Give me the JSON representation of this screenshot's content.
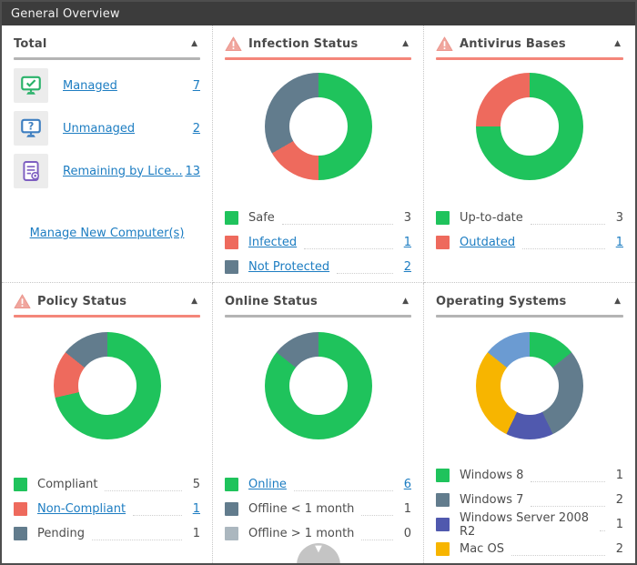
{
  "window": {
    "title": "General Overview"
  },
  "icons": {
    "collapse_arrow": "▲",
    "scroll_down_arrow": "▼"
  },
  "palette": {
    "green": "#1fc35c",
    "red": "#ee6a5d",
    "slate": "#627c8d",
    "light_gray": "#abb7bf",
    "indigo": "#5059ae",
    "yellow": "#f7b500",
    "light_blue": "#6b9bd2",
    "link_blue": "#1d7dc2",
    "warning_underline": "#f4867a",
    "neutral_underline": "#b4b4b4",
    "titlebar_bg": "#3c3c3c"
  },
  "panels": {
    "total": {
      "title": "Total",
      "rows": [
        {
          "label": "Managed",
          "value": "7"
        },
        {
          "label": "Unmanaged",
          "value": "2"
        },
        {
          "label": "Remaining by Lice...",
          "value": "13"
        }
      ],
      "footer_link": "Manage New Computer(s)"
    },
    "infection": {
      "title": "Infection Status",
      "has_warning": true
    },
    "antivirus": {
      "title": "Antivirus Bases",
      "has_warning": true
    },
    "policy": {
      "title": "Policy Status",
      "has_warning": true
    },
    "online": {
      "title": "Online Status",
      "has_warning": false
    },
    "os": {
      "title": "Operating Systems",
      "has_warning": false
    }
  },
  "chart_data": [
    {
      "type": "donut",
      "title": "Infection Status",
      "start": "12 o'clock, clockwise",
      "labels": [
        "Safe",
        "Infected",
        "Not Protected"
      ],
      "values": [
        3,
        1,
        2
      ],
      "colors": [
        "#1fc35c",
        "#ee6a5d",
        "#627c8d"
      ],
      "label_is_link": [
        false,
        true,
        true
      ]
    },
    {
      "type": "donut",
      "title": "Antivirus Bases",
      "start": "12 o'clock, clockwise",
      "labels": [
        "Up-to-date",
        "Outdated"
      ],
      "values": [
        3,
        1
      ],
      "colors": [
        "#1fc35c",
        "#ee6a5d"
      ],
      "label_is_link": [
        false,
        true
      ]
    },
    {
      "type": "donut",
      "title": "Policy Status",
      "start": "12 o'clock, clockwise",
      "labels": [
        "Compliant",
        "Non-Compliant",
        "Pending"
      ],
      "values": [
        5,
        1,
        1
      ],
      "colors": [
        "#1fc35c",
        "#ee6a5d",
        "#627c8d"
      ],
      "label_is_link": [
        false,
        true,
        false
      ]
    },
    {
      "type": "donut",
      "title": "Online Status",
      "start": "12 o'clock, clockwise",
      "labels": [
        "Online",
        "Offline < 1 month",
        "Offline > 1 month"
      ],
      "values": [
        6,
        1,
        0
      ],
      "colors": [
        "#1fc35c",
        "#627c8d",
        "#abb7bf"
      ],
      "label_is_link": [
        true,
        false,
        false
      ]
    },
    {
      "type": "donut",
      "title": "Operating Systems",
      "start": "12 o'clock, clockwise",
      "labels": [
        "Windows 8",
        "Windows 7",
        "Windows Server 2008 R2",
        "Mac OS",
        ""
      ],
      "values": [
        1,
        2,
        1,
        2,
        1
      ],
      "colors": [
        "#1fc35c",
        "#627c8d",
        "#5059ae",
        "#f7b500",
        "#6b9bd2"
      ],
      "label_is_link": [
        false,
        false,
        false,
        false,
        false
      ],
      "note_fifth_segment": "light-blue slice visible in donut; its legend row is scrolled out of view"
    }
  ]
}
